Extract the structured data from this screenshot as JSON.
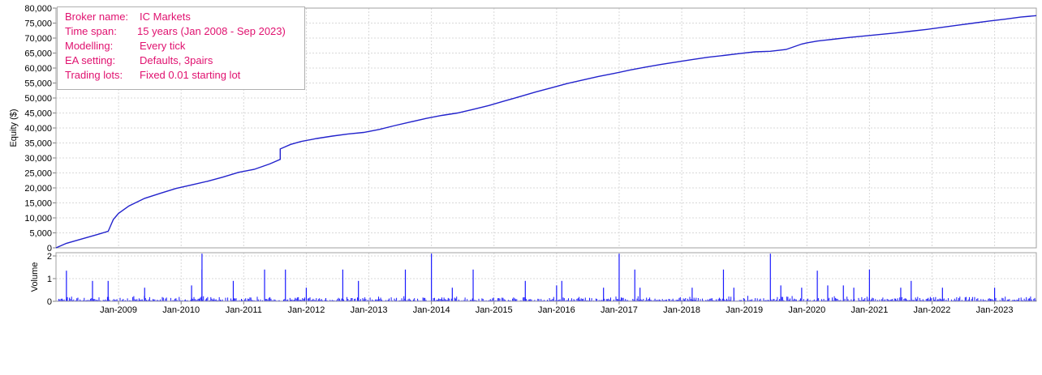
{
  "info_box": {
    "rows": [
      {
        "label": "Broker name:",
        "value": "IC Markets"
      },
      {
        "label": "Time span:",
        "value": "15  years (Jan 2008  - Sep 2023)"
      },
      {
        "label": "Modelling:",
        "value": "Every tick"
      },
      {
        "label": "EA setting:",
        "value": "Defaults, 3pairs"
      },
      {
        "label": "Trading lots:",
        "value": "Fixed 0.01  starting lot"
      }
    ],
    "text_color": "#e0116f"
  },
  "chart_data": [
    {
      "type": "line",
      "title": "",
      "xlabel": "",
      "ylabel": "Equity ($)",
      "ylim": [
        0,
        80000
      ],
      "yticks": [
        "0",
        "5,000",
        "10,000",
        "15,000",
        "20,000",
        "25,000",
        "30,000",
        "35,000",
        "40,000",
        "45,000",
        "50,000",
        "55,000",
        "60,000",
        "65,000",
        "70,000",
        "75,000",
        "80,000"
      ],
      "grid": true,
      "line_color": "#2222cc",
      "series": [
        {
          "x": [
            "2008-01",
            "2008-03",
            "2008-06",
            "2008-09",
            "2008-11",
            "2008-12",
            "2009-01",
            "2009-03",
            "2009-06",
            "2009-09",
            "2009-12",
            "2010-03",
            "2010-06",
            "2010-09",
            "2010-12",
            "2011-03",
            "2011-06",
            "2011-08",
            "2011-08",
            "2011-10",
            "2011-12",
            "2012-03",
            "2012-06",
            "2012-09",
            "2012-12",
            "2013-03",
            "2013-06",
            "2013-09",
            "2013-12",
            "2014-03",
            "2014-06",
            "2014-09",
            "2014-12",
            "2015-03",
            "2015-06",
            "2015-09",
            "2015-12",
            "2016-03",
            "2016-06",
            "2016-09",
            "2016-12",
            "2017-03",
            "2017-06",
            "2017-09",
            "2017-12",
            "2018-03",
            "2018-06",
            "2018-09",
            "2018-12",
            "2019-03",
            "2019-06",
            "2019-09",
            "2019-12",
            "2020-01",
            "2020-03",
            "2020-06",
            "2020-09",
            "2020-12",
            "2021-03",
            "2021-06",
            "2021-09",
            "2021-12",
            "2022-03",
            "2022-06",
            "2022-09",
            "2022-12",
            "2023-03",
            "2023-06",
            "2023-09"
          ],
          "y": [
            0,
            1500,
            3000,
            4500,
            5500,
            9500,
            11500,
            14000,
            16500,
            18200,
            19800,
            21000,
            22200,
            23600,
            25200,
            26200,
            28000,
            29500,
            33000,
            34500,
            35500,
            36500,
            37300,
            38000,
            38500,
            39500,
            40800,
            42000,
            43200,
            44200,
            45000,
            46200,
            47500,
            49000,
            50500,
            52000,
            53400,
            54800,
            56000,
            57200,
            58200,
            59300,
            60300,
            61200,
            62000,
            62800,
            63600,
            64200,
            64800,
            65400,
            65600,
            66200,
            68000,
            68400,
            69000,
            69600,
            70200,
            70700,
            71200,
            71700,
            72300,
            72900,
            73600,
            74300,
            75000,
            75700,
            76300,
            77000,
            77500
          ]
        }
      ]
    },
    {
      "type": "bar",
      "title": "",
      "xlabel": "",
      "ylabel": "Volume",
      "ylim": [
        0,
        2
      ],
      "yticks": [
        "0",
        "1",
        "2"
      ],
      "xticks": [
        "Jan-2009",
        "Jan-2010",
        "Jan-2011",
        "Jan-2012",
        "Jan-2013",
        "Jan-2014",
        "Jan-2015",
        "Jan-2016",
        "Jan-2017",
        "Jan-2018",
        "Jan-2019",
        "Jan-2020",
        "Jan-2021",
        "Jan-2022",
        "Jan-2023"
      ],
      "grid": true,
      "bar_color": "#1a1aff",
      "spikes": {
        "x": [
          "2008-03",
          "2008-08",
          "2008-11",
          "2009-06",
          "2010-03",
          "2010-05",
          "2010-05",
          "2010-11",
          "2011-05",
          "2011-09",
          "2012-01",
          "2012-08",
          "2012-11",
          "2013-08",
          "2014-01",
          "2014-05",
          "2014-09",
          "2015-07",
          "2016-01",
          "2016-02",
          "2016-10",
          "2017-01",
          "2017-04",
          "2017-05",
          "2018-03",
          "2018-09",
          "2018-11",
          "2019-06",
          "2019-08",
          "2019-12",
          "2020-03",
          "2020-05",
          "2020-08",
          "2020-10",
          "2021-01",
          "2021-07",
          "2021-09",
          "2022-03",
          "2023-01"
        ],
        "y": [
          1.35,
          0.9,
          0.9,
          0.6,
          0.7,
          2.1,
          1.4,
          0.9,
          1.4,
          1.4,
          0.6,
          1.4,
          0.9,
          1.4,
          2.1,
          0.6,
          1.4,
          0.9,
          0.7,
          0.9,
          0.6,
          2.1,
          1.4,
          0.6,
          0.6,
          1.4,
          0.6,
          2.1,
          0.7,
          0.6,
          1.35,
          0.7,
          0.7,
          0.6,
          1.4,
          0.6,
          0.9,
          0.6,
          0.6
        ]
      }
    }
  ]
}
